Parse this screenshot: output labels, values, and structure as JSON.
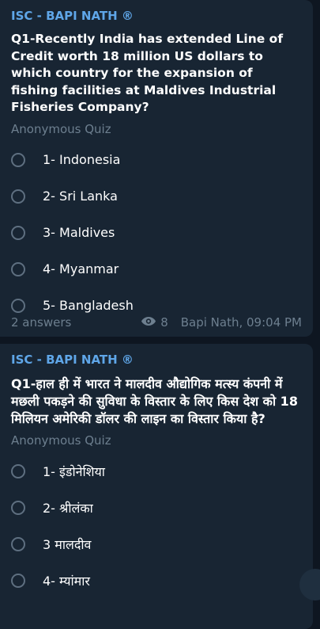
{
  "messages": [
    {
      "sender": "ISC - BAPI NATH ®",
      "question": "Q1-Recently India has extended Line of Credit worth 18 million US dollars to which country for the expansion of fishing facilities at Maldives Industrial Fisheries Company?",
      "quiz_type": "Anonymous Quiz",
      "options": [
        "1- Indonesia",
        "2- Sri Lanka",
        "3- Maldives",
        "4- Myanmar",
        "5- Bangladesh"
      ],
      "answers": "2 answers",
      "views": "8",
      "author_time": "Bapi Nath, 09:04 PM"
    },
    {
      "sender": "ISC - BAPI NATH ®",
      "question": "Q1-हाल ही में भारत ने मालदीव औद्योगिक मत्स्य कंपनी में मछली पकड़ने की सुविधा के विस्तार के लिए किस देश को 18 मिलियन अमेरिकी डॉलर की लाइन का विस्तार किया है?",
      "quiz_type": "Anonymous Quiz",
      "options": [
        "1- इंडोनेशिया",
        "2- श्रीलंका",
        "3 मालदीव",
        "4- म्यांमार"
      ]
    }
  ],
  "colors": {
    "background": "#0e1621",
    "bubble": "#182533",
    "sender": "#5fa6e8",
    "muted": "#6d7f8f"
  }
}
